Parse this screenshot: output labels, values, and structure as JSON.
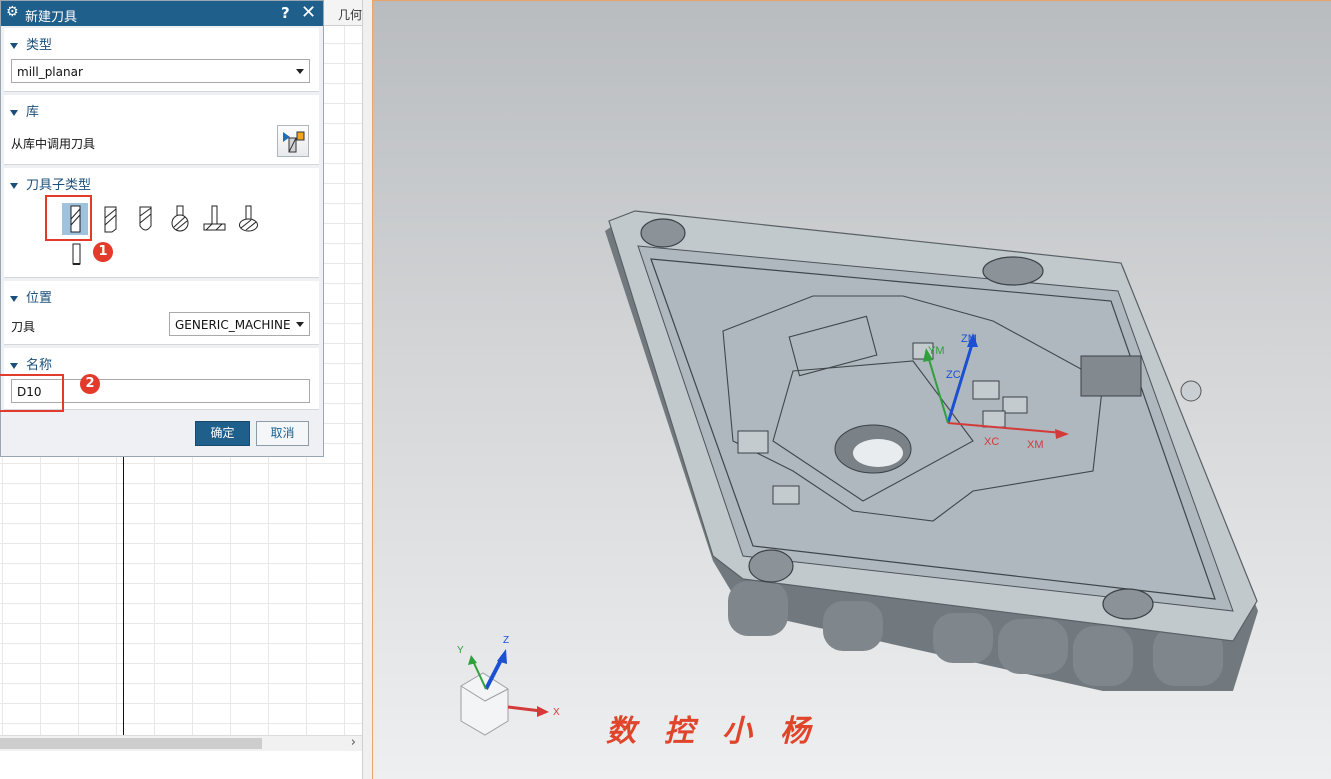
{
  "navigator": {
    "column_header": "几何"
  },
  "dialog": {
    "title": "新建刀具",
    "help_icon": "?",
    "close_icon": "✕",
    "type_section": {
      "heading": "类型",
      "selected": "mill_planar"
    },
    "library_section": {
      "heading": "库",
      "label": "从库中调用刀具"
    },
    "subtype_section": {
      "heading": "刀具子类型",
      "icons": [
        "mill-tool-icon",
        "chamfer-mill-icon",
        "ball-mill-icon",
        "spherical-mill-icon",
        "t-cutter-icon",
        "barrel-cutter-icon",
        "drill-icon"
      ]
    },
    "location_section": {
      "heading": "位置",
      "label": "刀具",
      "selected": "GENERIC_MACHINE"
    },
    "name_section": {
      "heading": "名称",
      "value": "D10"
    },
    "ok_label": "确定",
    "cancel_label": "取消"
  },
  "annotations": {
    "badge1": "1",
    "badge2": "2"
  },
  "viewport": {
    "wcs_labels": {
      "ym": "YM",
      "zm": "ZM",
      "zc": "ZC",
      "xc": "XC",
      "xm": "XM"
    },
    "triad_labels": {
      "x": "X",
      "y": "Y",
      "z": "Z"
    },
    "watermark": "数控小杨"
  },
  "colors": {
    "title_bar": "#1f5f8b",
    "section_heading": "#1b4f7a",
    "highlight": "#e23b2b",
    "model_face": "#a9b2b8",
    "model_shadow": "#6f777c"
  }
}
